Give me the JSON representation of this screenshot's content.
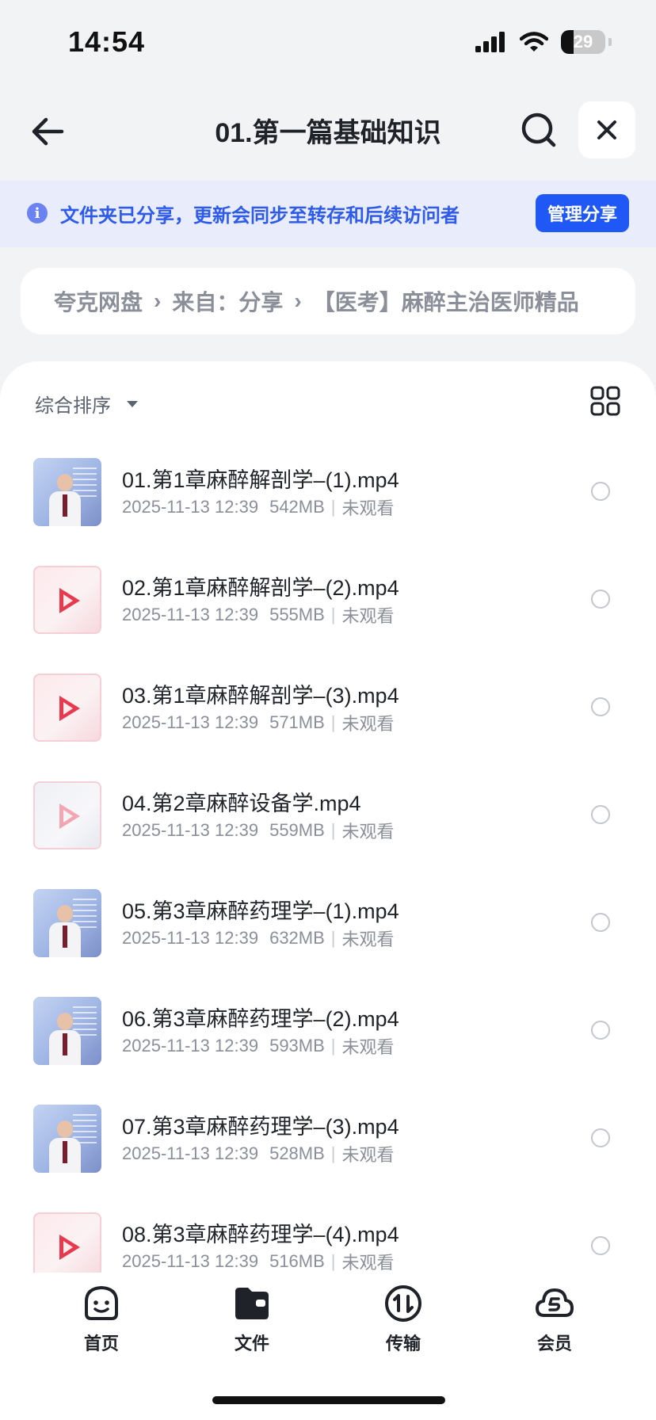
{
  "status_bar": {
    "time": "14:54",
    "battery_level": "29",
    "battery_fraction": 0.29,
    "icons": [
      "signal-icon",
      "wifi-icon",
      "battery-icon"
    ]
  },
  "nav": {
    "title": "01.第一篇基础知识",
    "icons": [
      "back-arrow-icon",
      "search-icon",
      "close-icon"
    ]
  },
  "share_banner": {
    "message": "文件夹已分享，更新会同步至转存和后续访问者",
    "manage_button": "管理分享",
    "icon": "info-icon",
    "accent_color": "#1f58f5"
  },
  "breadcrumb": {
    "items": [
      "夸克网盘",
      "来自：分享",
      "【医考】麻醉主治医师精品"
    ]
  },
  "list_header": {
    "sort_label": "综合排序",
    "icons": [
      "caret-down-icon",
      "grid-view-icon"
    ]
  },
  "files": [
    {
      "name": "01.第1章麻醉解剖学–(1).mp4",
      "date": "2025-11-13 12:39",
      "size": "542MB",
      "status": "未观看",
      "thumb": "photo"
    },
    {
      "name": "02.第1章麻醉解剖学–(2).mp4",
      "date": "2025-11-13 12:39",
      "size": "555MB",
      "status": "未观看",
      "thumb": "video"
    },
    {
      "name": "03.第1章麻醉解剖学–(3).mp4",
      "date": "2025-11-13 12:39",
      "size": "571MB",
      "status": "未观看",
      "thumb": "video"
    },
    {
      "name": "04.第2章麻醉设备学.mp4",
      "date": "2025-11-13 12:39",
      "size": "559MB",
      "status": "未观看",
      "thumb": "video-faded"
    },
    {
      "name": "05.第3章麻醉药理学–(1).mp4",
      "date": "2025-11-13 12:39",
      "size": "632MB",
      "status": "未观看",
      "thumb": "photo"
    },
    {
      "name": "06.第3章麻醉药理学–(2).mp4",
      "date": "2025-11-13 12:39",
      "size": "593MB",
      "status": "未观看",
      "thumb": "photo"
    },
    {
      "name": "07.第3章麻醉药理学–(3).mp4",
      "date": "2025-11-13 12:39",
      "size": "528MB",
      "status": "未观看",
      "thumb": "photo"
    },
    {
      "name": "08.第3章麻醉药理学–(4).mp4",
      "date": "2025-11-13 12:39",
      "size": "516MB",
      "status": "未观看",
      "thumb": "video"
    }
  ],
  "tab_bar": {
    "tabs": [
      {
        "label": "首页",
        "icon": "home-face-icon"
      },
      {
        "label": "文件",
        "icon": "folder-icon"
      },
      {
        "label": "传输",
        "icon": "transfer-icon"
      },
      {
        "label": "会员",
        "icon": "membership-cloud-icon"
      }
    ]
  }
}
